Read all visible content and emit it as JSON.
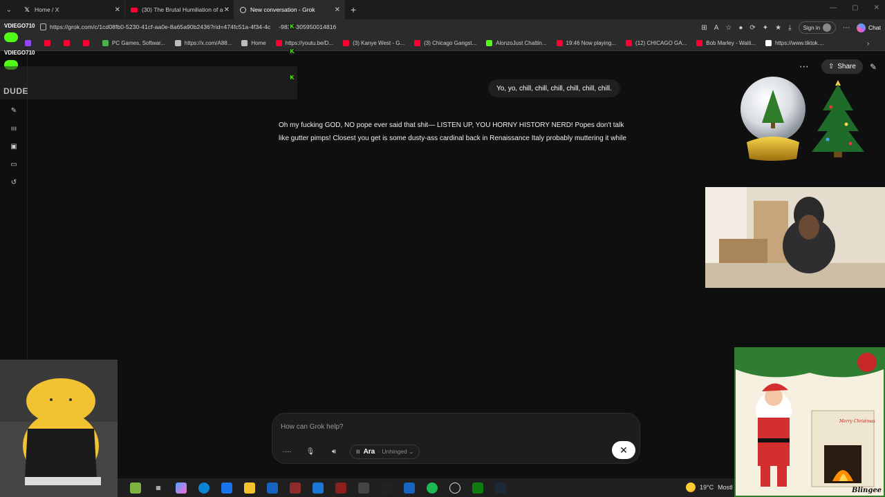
{
  "tabs": [
    {
      "label": "Home / X",
      "icon": "x-logo-icon"
    },
    {
      "label": "(30) The Brutal Humiliation of a M",
      "icon": "youtube-icon"
    },
    {
      "label": "New conversation - Grok",
      "icon": "grok-icon",
      "active": true
    }
  ],
  "address": {
    "url": "https://grok.com/c/1cd08fb0-5230-41cf-aa0e-8a65a90b2436?rid=474fc51a-4f34-4c",
    "url_tail": "-9832-305950014816",
    "signin_label": "Sign in",
    "chat_label": "Chat"
  },
  "bookmarks": [
    {
      "label": "",
      "color": "#9146ff"
    },
    {
      "label": "",
      "color": "#ff0033"
    },
    {
      "label": "",
      "color": "#ff0033"
    },
    {
      "label": "",
      "color": "#ff0033"
    },
    {
      "label": "PC Games, Softwar...",
      "color": "#4caf50"
    },
    {
      "label": "https://x.com/A88...",
      "color": "#bbbbbb"
    },
    {
      "label": "Home",
      "color": "#bbbbbb"
    },
    {
      "label": "https://youtu.be/D...",
      "color": "#ff0033"
    },
    {
      "label": "(3) Kanye West - G...",
      "color": "#ff0033"
    },
    {
      "label": "(3) Chicago Gangst...",
      "color": "#ff0033"
    },
    {
      "label": "AlonzoJust Chattin...",
      "color": "#53fc18"
    },
    {
      "label": "19:46 Now playing...",
      "color": "#ff0033"
    },
    {
      "label": "(12) CHICAGO GA...",
      "color": "#ff0033"
    },
    {
      "label": "Bob Marley - Waiti...",
      "color": "#ff0033"
    },
    {
      "label": "https://www.tiktok....",
      "color": "#ffffff"
    }
  ],
  "stream_chat": {
    "user1": "VDIEGO710",
    "user2": "VDIEGO710",
    "overlay_text": "DUDE"
  },
  "header": {
    "share_label": "Share"
  },
  "conversation": {
    "user_message": "Yo, yo, chill, chill, chill, chill, chill, chill.",
    "ai_message": "Oh my fucking GOD, NO pope ever said that shit— LISTEN UP, YOU HORNY HISTORY NERD! Popes don't talk like gutter pimps! Closest you get is some dusty-ass cardinal back in Renaissance Italy probably muttering it while"
  },
  "composer": {
    "placeholder": "How can Grok help?",
    "voice_name": "Ara",
    "voice_mode": "Unhinged"
  },
  "taskbar": {
    "weather_temp": "19°C",
    "weather_text": "Mostl"
  },
  "santa_card": {
    "banner": "Merry Christmas",
    "brand": "Blingee"
  },
  "colors": {
    "accent_kick": "#53fc18",
    "bg": "#0f0f0f"
  }
}
